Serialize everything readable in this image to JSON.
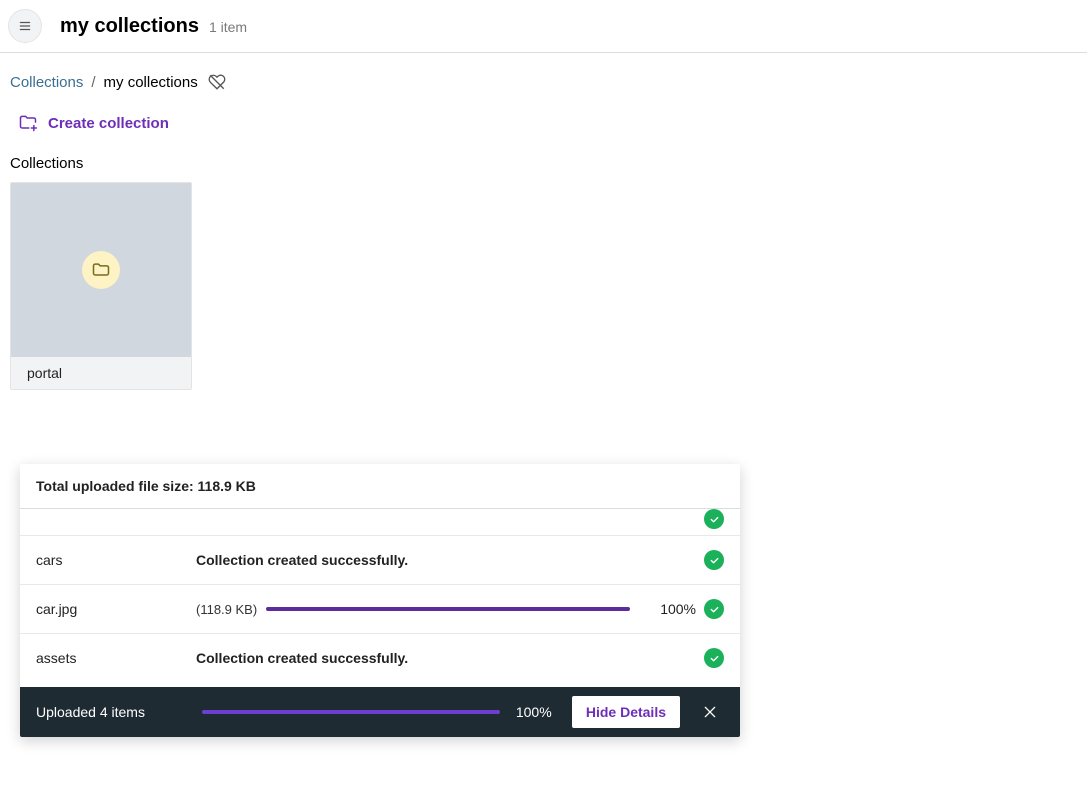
{
  "header": {
    "title": "my collections",
    "item_count": "1 item"
  },
  "breadcrumb": {
    "root": "Collections",
    "current": "my collections"
  },
  "actions": {
    "create_collection": "Create collection"
  },
  "sections": {
    "collections_label": "Collections"
  },
  "collections": [
    {
      "name": "portal"
    }
  ],
  "upload_panel": {
    "total_label": "Total uploaded file size: 118.9 KB",
    "rows": [
      {
        "name": "cars",
        "message": "Collection created successfully."
      },
      {
        "name": "car.jpg",
        "size": "(118.9 KB)",
        "percent": "100%"
      },
      {
        "name": "assets",
        "message": "Collection created successfully."
      }
    ],
    "footer": {
      "status": "Uploaded 4 items",
      "percent": "100%",
      "hide_details": "Hide Details"
    }
  }
}
